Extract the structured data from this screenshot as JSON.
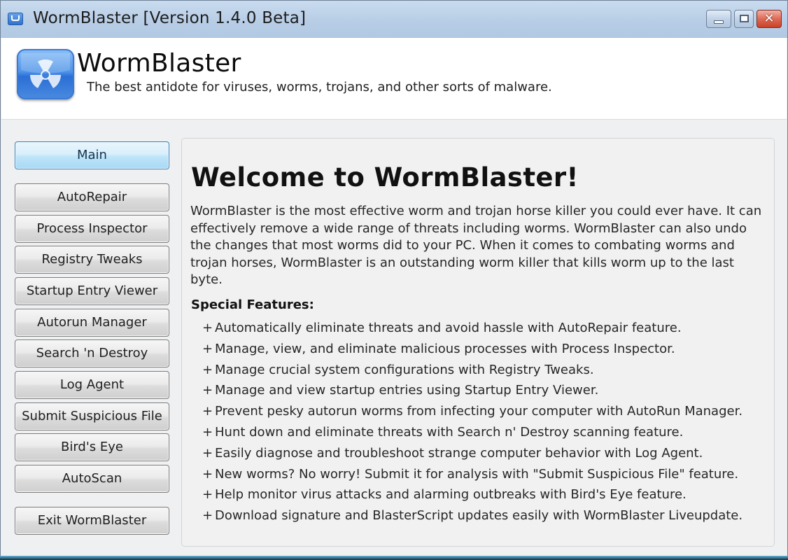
{
  "window": {
    "title": "WormBlaster [Version 1.4.0 Beta]",
    "icon": "app-icon",
    "controls": {
      "minimize": "minimize-icon",
      "maximize": "maximize-icon",
      "close": "close-icon",
      "close_glyph": "✕"
    }
  },
  "header": {
    "logo_icon": "radiation-icon",
    "app_name": "WormBlaster",
    "tagline": "The best antidote for viruses, worms, trojans, and other sorts of malware."
  },
  "sidebar": {
    "items": [
      {
        "label": "Main",
        "active": true
      },
      {
        "label": "AutoRepair"
      },
      {
        "label": "Process Inspector"
      },
      {
        "label": "Registry Tweaks"
      },
      {
        "label": "Startup Entry Viewer"
      },
      {
        "label": "Autorun Manager"
      },
      {
        "label": "Search 'n Destroy"
      },
      {
        "label": "Log Agent"
      },
      {
        "label": "Submit Suspicious File"
      },
      {
        "label": "Bird's Eye"
      },
      {
        "label": "AutoScan"
      }
    ],
    "exit_label": "Exit WormBlaster"
  },
  "main": {
    "heading": "Welcome to WormBlaster!",
    "description": "WormBlaster is the most effective worm and trojan horse killer you could ever have. It can effectively remove a wide range of threats including worms. WormBlaster can also undo the changes that most worms did to your PC. When it comes to combating worms and trojan horses, WormBlaster is an outstanding worm killer that kills worm up to the last byte.",
    "features_title": "Special Features:",
    "bullet": "+",
    "features": [
      "Automatically eliminate threats and avoid hassle with AutoRepair feature.",
      "Manage, view, and eliminate malicious processes with Process Inspector.",
      "Manage crucial system configurations with Registry Tweaks.",
      "Manage and view startup entries using Startup Entry Viewer.",
      "Prevent pesky autorun worms from infecting your computer with AutoRun Manager.",
      "Hunt down and eliminate threats with Search n' Destroy scanning feature.",
      "Easily diagnose and troubleshoot strange computer behavior with Log Agent.",
      "New worms? No worry! Submit it for analysis with \"Submit Suspicious File\" feature.",
      "Help monitor virus attacks and alarming outbreaks with Bird's Eye feature.",
      "Download signature and BlasterScript updates easily with WormBlaster Liveupdate."
    ]
  },
  "colors": {
    "active_button": "#bee4f9",
    "titlebar": "#b7cde6",
    "close_button": "#de6a55",
    "logo_blue": "#2a6fd6"
  }
}
